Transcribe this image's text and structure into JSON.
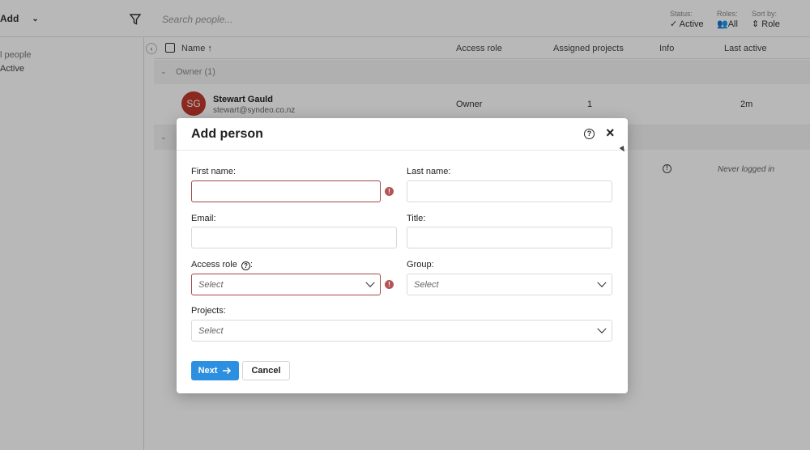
{
  "toolbar": {
    "add_label": "Add",
    "search_placeholder": "Search people...",
    "status_label": "Status:",
    "status_value": "Active",
    "roles_label": "Roles:",
    "roles_value": "All",
    "sort_label": "Sort by:",
    "sort_value": "Role"
  },
  "sidebar": {
    "items": [
      {
        "label": "l people"
      },
      {
        "label": "Active"
      }
    ]
  },
  "table": {
    "columns": [
      "Name ↑",
      "Access role",
      "Assigned projects",
      "Info",
      "Last active"
    ],
    "groups": [
      {
        "label": "Owner (1)"
      }
    ],
    "rows": [
      {
        "initials": "SG",
        "name": "Stewart Gauld",
        "email": "stewart@syndeo.co.nz",
        "role": "Owner",
        "projects": "1",
        "last_active": "2m"
      },
      {
        "last_active": "Never logged in"
      }
    ]
  },
  "modal": {
    "title": "Add person",
    "fields": {
      "first_name": {
        "label": "First name:",
        "value": "",
        "placeholder": ""
      },
      "last_name": {
        "label": "Last name:",
        "value": "",
        "placeholder": ""
      },
      "email": {
        "label": "Email:",
        "value": "",
        "placeholder": ""
      },
      "title": {
        "label": "Title:",
        "value": "",
        "placeholder": ""
      },
      "access_role": {
        "label": "Access role",
        "colon": ":",
        "selected": "Select"
      },
      "group": {
        "label": "Group:",
        "selected": "Select"
      },
      "projects": {
        "label": "Projects:",
        "selected": "Select"
      }
    },
    "next_label": "Next",
    "cancel_label": "Cancel"
  },
  "colors": {
    "accent": "#2d8fe0",
    "error": "#a34848",
    "avatar": "#c0392b"
  },
  "icons": [
    "filter-icon",
    "chevron-down-icon",
    "checkbox-icon",
    "help-icon",
    "close-icon",
    "error-icon",
    "arrow-right-icon",
    "info-icon"
  ]
}
